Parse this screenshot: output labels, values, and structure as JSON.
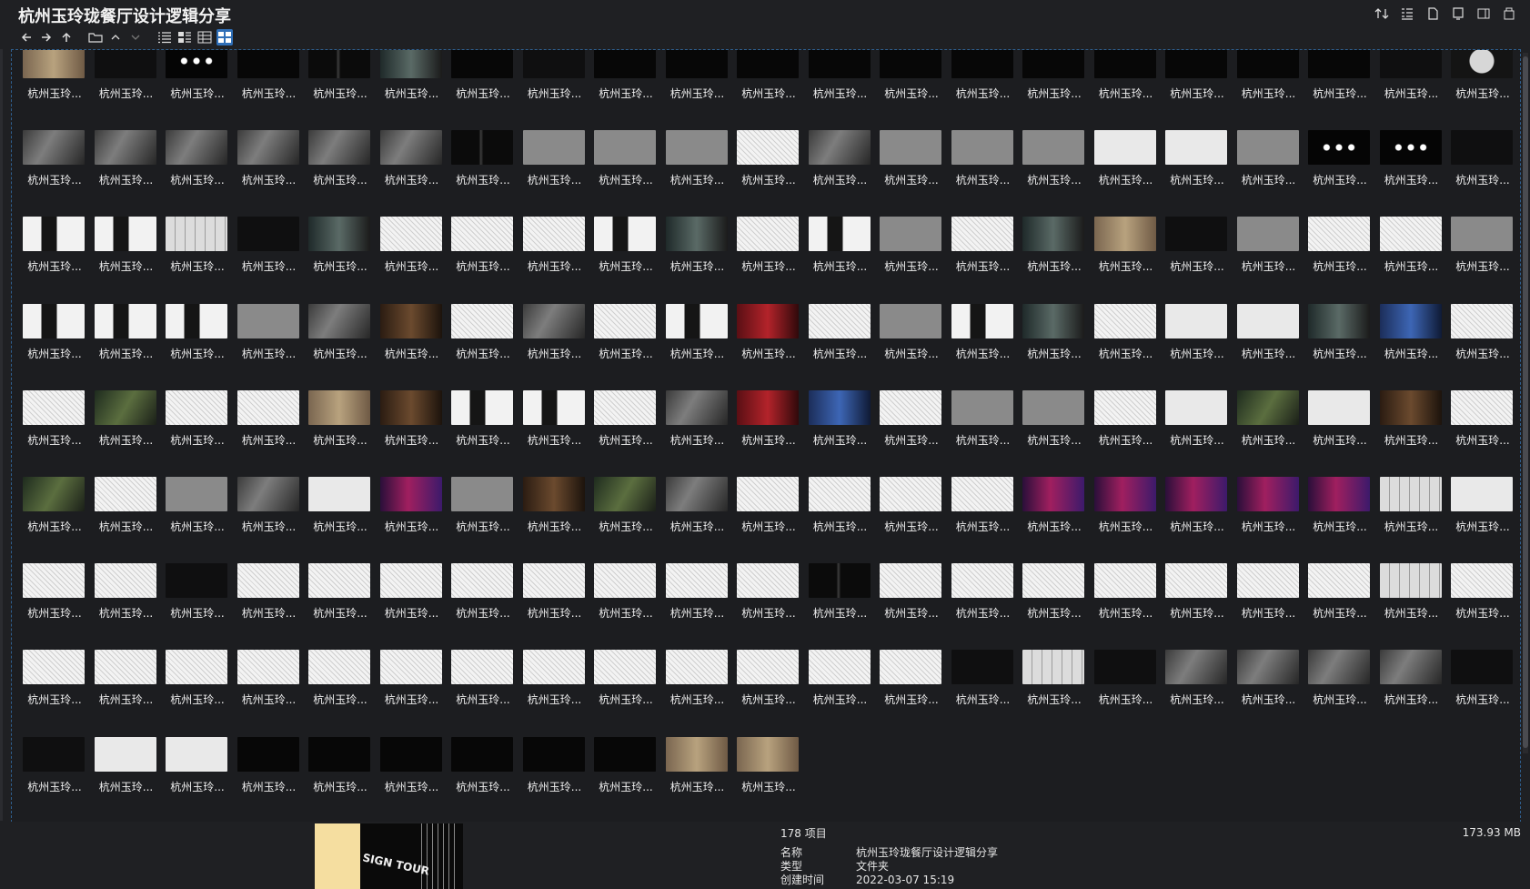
{
  "window": {
    "title": "杭州玉玲珑餐厅设计逻辑分享"
  },
  "toolbar": {
    "nav": [
      {
        "name": "back-icon",
        "glyph": "←"
      },
      {
        "name": "forward-icon",
        "glyph": "→"
      },
      {
        "name": "up-icon",
        "glyph": "↑"
      },
      {
        "name": "folder-icon",
        "glyph": "🗀"
      },
      {
        "name": "chevron-up-icon",
        "glyph": "⌃"
      },
      {
        "name": "chevron-down-icon",
        "glyph": "⌄"
      }
    ],
    "views": [
      "list-view-icon",
      "details-view-icon",
      "tiles-view-icon",
      "thumbnail-view-icon"
    ],
    "right": [
      "sort-icon",
      "group-icon",
      "new-file-icon",
      "preview-pane-icon",
      "details-pane-icon",
      "copy-icon"
    ]
  },
  "files": {
    "caption": "杭州玉玲...",
    "count": 178,
    "thumbs": [
      "t-tan",
      "t-dark",
      "t-dots",
      "t-black",
      "t-ink",
      "t-photo2",
      "t-black",
      "t-dark",
      "t-black",
      "t-black",
      "t-black",
      "t-black",
      "t-black",
      "t-black",
      "t-black",
      "t-black",
      "t-black",
      "t-black",
      "t-black",
      "t-dark",
      "t-moon",
      "t-photo1",
      "t-photo1",
      "t-photo1",
      "t-photo1",
      "t-photo1",
      "t-photo1",
      "t-ink",
      "t-gray",
      "t-gray",
      "t-gray",
      "t-sketch",
      "t-photo1",
      "t-gray",
      "t-gray",
      "t-gray",
      "t-light",
      "t-light",
      "t-gray",
      "t-dots",
      "t-dots",
      "t-dark",
      "t-bw",
      "t-bw",
      "t-grid",
      "t-dark",
      "t-photo2",
      "t-sketch",
      "t-sketch",
      "t-sketch",
      "t-bw",
      "t-photo2",
      "t-sketch",
      "t-bw",
      "t-gray",
      "t-sketch",
      "t-photo2",
      "t-tan",
      "t-dark",
      "t-gray",
      "t-sketch",
      "t-sketch",
      "t-gray",
      "t-bw",
      "t-bw",
      "t-bw",
      "t-gray",
      "t-photo1",
      "t-brown",
      "t-sketch",
      "t-photo1",
      "t-sketch",
      "t-bw",
      "t-red",
      "t-sketch",
      "t-gray",
      "t-bw",
      "t-photo2",
      "t-sketch",
      "t-light",
      "t-light",
      "t-photo2",
      "t-blue",
      "t-sketch",
      "t-sketch",
      "t-green",
      "t-sketch",
      "t-sketch",
      "t-tan",
      "t-brown",
      "t-bw",
      "t-bw",
      "t-sketch",
      "t-photo1",
      "t-red",
      "t-blue",
      "t-sketch",
      "t-gray",
      "t-gray",
      "t-sketch",
      "t-light",
      "t-green",
      "t-light",
      "t-brown",
      "t-sketch",
      "t-green",
      "t-sketch",
      "t-gray",
      "t-photo1",
      "t-light",
      "t-purple",
      "t-gray",
      "t-brown",
      "t-green",
      "t-photo1",
      "t-sketch",
      "t-sketch",
      "t-sketch",
      "t-sketch",
      "t-purple",
      "t-purple",
      "t-purple",
      "t-purple",
      "t-purple",
      "t-grid",
      "t-light",
      "t-sketch",
      "t-sketch",
      "t-dark",
      "t-sketch",
      "t-sketch",
      "t-sketch",
      "t-sketch",
      "t-sketch",
      "t-sketch",
      "t-sketch",
      "t-sketch",
      "t-ink",
      "t-sketch",
      "t-sketch",
      "t-sketch",
      "t-sketch",
      "t-sketch",
      "t-sketch",
      "t-sketch",
      "t-grid",
      "t-sketch",
      "t-sketch",
      "t-sketch",
      "t-sketch",
      "t-sketch",
      "t-sketch",
      "t-sketch",
      "t-sketch",
      "t-sketch",
      "t-sketch",
      "t-sketch",
      "t-sketch",
      "t-sketch",
      "t-sketch",
      "t-dark",
      "t-grid",
      "t-dark",
      "t-photo1",
      "t-photo1",
      "t-photo1",
      "t-photo1",
      "t-dark",
      "t-dark",
      "t-light",
      "t-light",
      "t-black",
      "t-black",
      "t-black",
      "t-black",
      "t-black",
      "t-black",
      "t-tan",
      "t-tan"
    ]
  },
  "status": {
    "count_text": "178 项目",
    "size_text": "173.93 MB",
    "props": [
      {
        "key": "名称",
        "value": "杭州玉玲珑餐厅设计逻辑分享"
      },
      {
        "key": "类型",
        "value": "文件夹"
      },
      {
        "key": "创建时间",
        "value": "2022-03-07  15:19"
      }
    ],
    "preview_text": "SIGN TOUR"
  },
  "colors": {
    "accent": "#2f6fb8",
    "bg": "#1f2023"
  }
}
